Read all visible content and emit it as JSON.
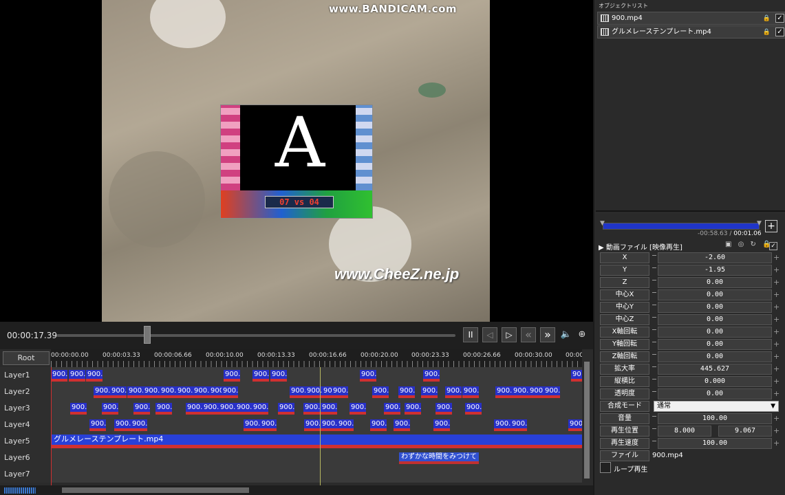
{
  "preview": {
    "watermark_top": "www.BANDICAM.com",
    "watermark_bottom": "www.CheeZ.ne.jp",
    "overlay_letter": "A",
    "overlay_score": "07 vs 04"
  },
  "transport": {
    "timecode": "00:00:17.39",
    "scrub_position": 0.227,
    "buttons": {
      "pause": "II",
      "prev_frame": "◁",
      "next_frame": "▷",
      "rewind": "«",
      "forward": "»",
      "volume": "🔈",
      "zoom": "⊕"
    }
  },
  "timeline": {
    "root_label": "Root",
    "ruler": [
      "00:00:00.00",
      "00:00:03.33",
      "00:00:06.66",
      "00:00:10.00",
      "00:00:13.33",
      "00:00:16.66",
      "00:00:20.00",
      "00:00:23.33",
      "00:00:26.66",
      "00:00:30.00",
      "00:00"
    ],
    "layers": [
      {
        "name": "Layer1",
        "clips": [
          "900.",
          "900.",
          "900.",
          "900.",
          "900.",
          "900.",
          "900.",
          "900.",
          "90"
        ]
      },
      {
        "name": "Layer2",
        "clips": [
          "900.",
          "900.",
          "900.",
          "900.",
          "900.",
          "900.",
          "900.",
          "900.",
          "900.",
          "900.",
          "900.",
          "900.",
          "900.",
          "900.",
          "900.",
          "900.",
          "900.",
          "900.",
          "900.",
          "900.",
          "900.",
          "900."
        ]
      },
      {
        "name": "Layer3",
        "clips": [
          "900.",
          "900.",
          "900.",
          "900.",
          "900.",
          "900.",
          "900.",
          "900.",
          "900.",
          "900.",
          "900.",
          "900.",
          "900.",
          "900.",
          "900.",
          "900.",
          "900."
        ]
      },
      {
        "name": "Layer4",
        "clips": [
          "900.",
          "900.",
          "900.",
          "900.",
          "900.",
          "900.",
          "900.",
          "900.",
          "900.",
          "900.",
          "900.",
          "900.",
          "900.",
          "900."
        ]
      },
      {
        "name": "Layer5",
        "clip_long": "グルメレーステンプレート.mp4"
      },
      {
        "name": "Layer6",
        "clip_text": "わずかな時間をみつけて"
      },
      {
        "name": "Layer7"
      }
    ]
  },
  "object_list": {
    "title": "オブジェクトリスト",
    "items": [
      {
        "name": "900.mp4",
        "checked": "✓"
      },
      {
        "name": "グルメレーステンプレート.mp4",
        "checked": "✓"
      }
    ]
  },
  "properties": {
    "range_left": "",
    "range_right": "",
    "range_neg": "-00:58.63",
    "range_sep": "/",
    "range_pos": "00:01.06",
    "add": "+",
    "section_title": "動画ファイル [映像再生]",
    "section_icons": "▣ ◎ ↻ 🔒",
    "section_check": "✓",
    "rows": [
      {
        "label": "X",
        "value": "-2.60"
      },
      {
        "label": "Y",
        "value": "-1.95"
      },
      {
        "label": "Z",
        "value": "0.00"
      },
      {
        "label": "中心X",
        "value": "0.00"
      },
      {
        "label": "中心Y",
        "value": "0.00"
      },
      {
        "label": "中心Z",
        "value": "0.00"
      },
      {
        "label": "X軸回転",
        "value": "0.00"
      },
      {
        "label": "Y軸回転",
        "value": "0.00"
      },
      {
        "label": "Z軸回転",
        "value": "0.00"
      },
      {
        "label": "拡大率",
        "value": "445.627"
      },
      {
        "label": "縦横比",
        "value": "0.000"
      },
      {
        "label": "透明度",
        "value": "0.00"
      }
    ],
    "blend_label": "合成モード",
    "blend_value": "通常",
    "volume_label": "音量",
    "volume_value": "100.00",
    "playpos_label": "再生位置",
    "playpos_start": "8.000",
    "playpos_end": "9.067",
    "speed_label": "再生速度",
    "speed_value": "100.00",
    "file_label": "ファイル",
    "file_value": "900.mp4",
    "loop_label": "ループ再生"
  }
}
